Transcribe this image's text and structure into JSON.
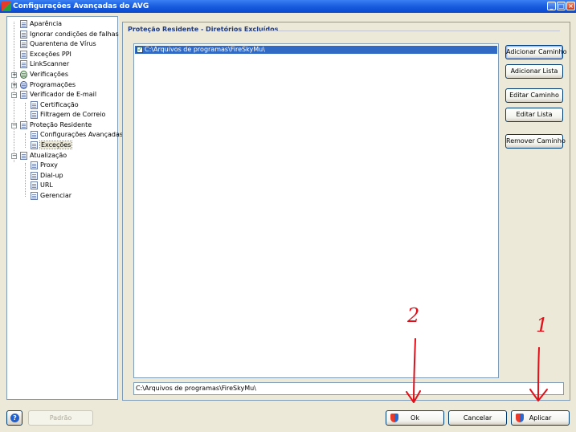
{
  "window": {
    "title": "Configurações Avançadas do AVG"
  },
  "tree": {
    "items": [
      {
        "label": "Aparência"
      },
      {
        "label": "Ignorar condições de falhas"
      },
      {
        "label": "Quarentena de Vírus"
      },
      {
        "label": "Exceções PPI"
      },
      {
        "label": "LinkScanner"
      },
      {
        "label": "Verificações"
      },
      {
        "label": "Programações"
      },
      {
        "label": "Verificador de E-mail"
      },
      {
        "label": "Certificação"
      },
      {
        "label": "Filtragem de Correio"
      },
      {
        "label": "Proteção Residente"
      },
      {
        "label": "Configurações Avançadas"
      },
      {
        "label": "Exceções"
      },
      {
        "label": "Atualização"
      },
      {
        "label": "Proxy"
      },
      {
        "label": "Dial-up"
      },
      {
        "label": "URL"
      },
      {
        "label": "Gerenciar"
      }
    ]
  },
  "main": {
    "section_title": "Proteção Residente - Diretórios Excluídos",
    "excluded_dirs": [
      {
        "path": "C:\\Arquivos de programas\\FireSkyMu\\",
        "checked": true
      }
    ],
    "buttons": {
      "add_path": "Adicionar Caminho",
      "add_list": "Adicionar Lista",
      "edit_path": "Editar Caminho",
      "edit_list": "Editar Lista",
      "remove_path": "Remover Caminho"
    },
    "path_field_value": "C:\\Arquivos de programas\\FireSkyMu\\"
  },
  "footer": {
    "default_label": "Padrão",
    "ok_label": "Ok",
    "cancel_label": "Cancelar",
    "apply_label": "Aplicar"
  },
  "annotations": {
    "one": "1",
    "two": "2",
    "color": "#e0101a"
  }
}
